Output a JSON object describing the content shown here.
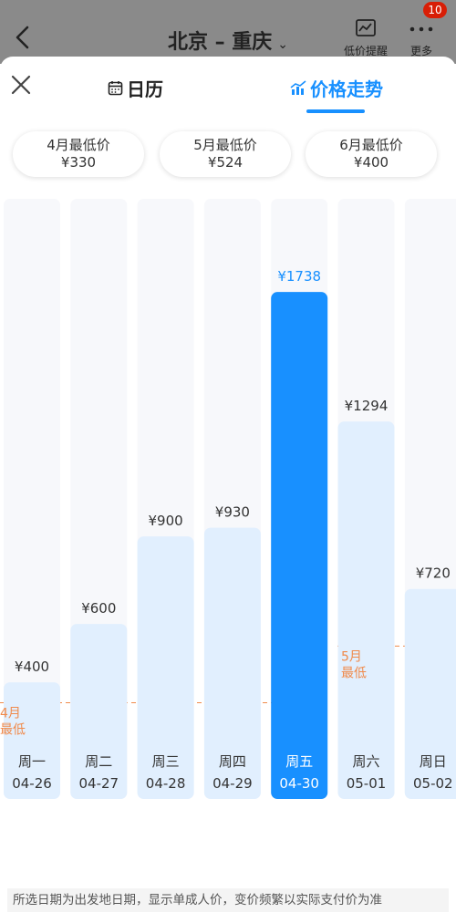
{
  "header": {
    "title": "北京 – 重庆",
    "alert_label": "低价提醒",
    "more_label": "更多",
    "badge": "10"
  },
  "tabs": [
    {
      "label": "日历"
    },
    {
      "label": "价格走势"
    }
  ],
  "month_lows": [
    {
      "title": "4月最低价",
      "price": "¥330"
    },
    {
      "title": "5月最低价",
      "price": "¥524"
    },
    {
      "title": "6月最低价",
      "price": "¥400"
    }
  ],
  "colors": {
    "accent": "#1890ff",
    "bar": "#e1effe",
    "bar_bg": "#f7f8fb",
    "low_line": "#f08a4b"
  },
  "chart_data": {
    "type": "bar",
    "currency": "¥",
    "categories": [
      "04-26",
      "04-27",
      "04-28",
      "04-29",
      "04-30",
      "05-01",
      "05-02"
    ],
    "weekdays": [
      "周一",
      "周二",
      "周三",
      "周四",
      "周五",
      "周六",
      "周日"
    ],
    "values": [
      400,
      600,
      900,
      930,
      1738,
      1294,
      720
    ],
    "selected": "04-30",
    "reference_lines": [
      {
        "month": "04",
        "label_line1": "4月",
        "label_line2": "最低",
        "value": 330
      },
      {
        "month": "05",
        "label_line1": "5月",
        "label_line2": "最低",
        "value": 524
      }
    ]
  },
  "footnote": "所选日期为出发地日期，显示单成人价，变价频繁以实际支付价为准"
}
